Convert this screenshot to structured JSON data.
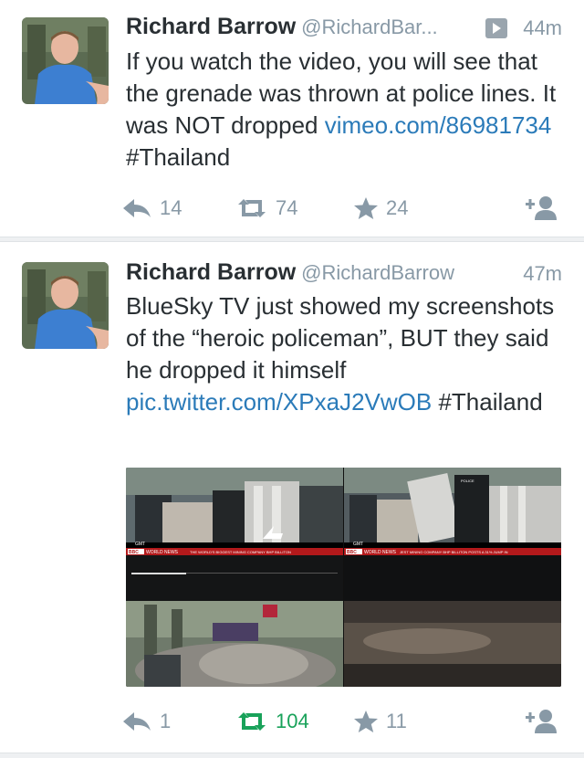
{
  "tweets": [
    {
      "name": "Richard Barrow",
      "handle": "@RichardBar...",
      "time": "44m",
      "text_parts": [
        "If you watch the video, you will see that the grenade was thrown at police lines. It was NOT dropped "
      ],
      "link": "vimeo.com/86981734",
      "hashtag": " #Thailand",
      "replies": "14",
      "retweets": "74",
      "favorites": "24",
      "has_media_badge": true
    },
    {
      "name": "Richard Barrow",
      "handle": "@RichardBarrow",
      "time": "47m",
      "text": "BlueSky TV just showed my screenshots of the “heroic policeman”, BUT they said he dropped it himself ",
      "link": "pic.twitter.com/XPxaJ2VwOB",
      "hashtag": " #Thailand",
      "replies": "1",
      "retweets": "104",
      "favorites": "11",
      "media_labels": {
        "gmt": "GMT",
        "bbc": "BBC",
        "world_news": "WORLD NEWS",
        "ticker_left": "THE WORLD'S BIGGEST MINING COMPANY BHP BILLITON",
        "ticker_right": "JEST MINING COMPANY BHP BILLITON POSTS A 31% JUMP IN",
        "police": "POLICE"
      }
    }
  ],
  "icons": [
    "reply-icon",
    "retweet-icon",
    "favorite-icon",
    "follow-icon",
    "media-badge-icon"
  ],
  "colors": {
    "link": "#2b7bb9",
    "muted": "#8899a6",
    "retweet_active": "#19a25a",
    "separator": "#eef0f2"
  }
}
